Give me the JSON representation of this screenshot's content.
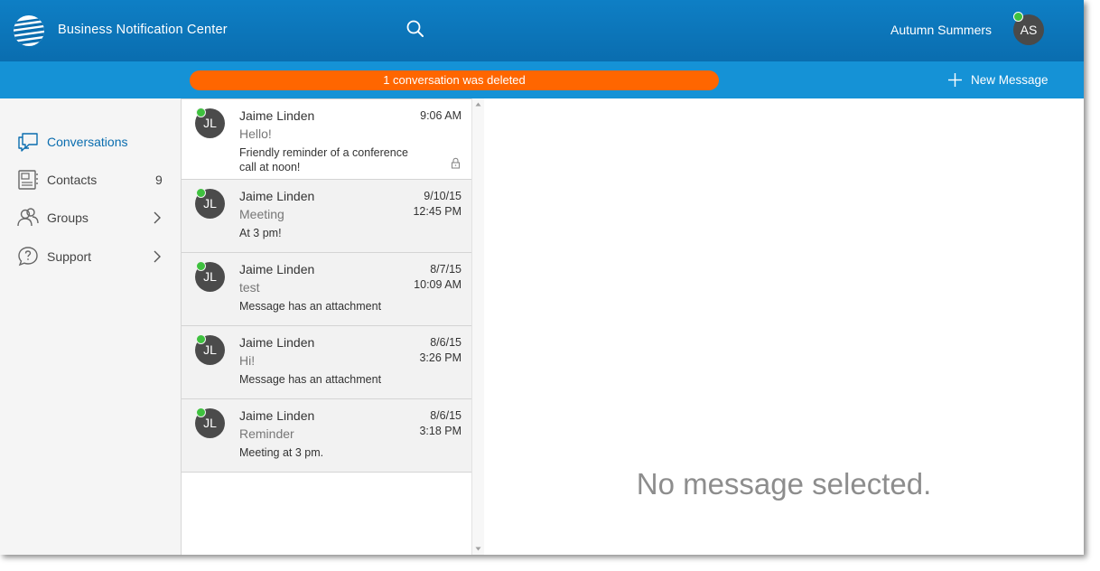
{
  "header": {
    "app_title": "Business Notification Center",
    "user_name": "Autumn Summers",
    "user_initials": "AS"
  },
  "subbar": {
    "toast": "1 conversation was deleted",
    "new_message_label": "New Message"
  },
  "sidebar": {
    "items": [
      {
        "label": "Conversations",
        "icon": "conversations-icon"
      },
      {
        "label": "Contacts",
        "count": "9",
        "icon": "contacts-icon"
      },
      {
        "label": "Groups",
        "icon": "groups-icon"
      },
      {
        "label": "Support",
        "icon": "support-icon"
      }
    ]
  },
  "conversations": [
    {
      "initials": "JL",
      "name": "Jaime Linden",
      "date": "9:06 AM",
      "time": "",
      "subject": "Hello!",
      "preview": "Friendly reminder of a conference call at noon!"
    },
    {
      "initials": "JL",
      "name": "Jaime Linden",
      "date": "9/10/15",
      "time": "12:45 PM",
      "subject": "Meeting",
      "preview": "At 3 pm!"
    },
    {
      "initials": "JL",
      "name": "Jaime Linden",
      "date": "8/7/15",
      "time": "10:09 AM",
      "subject": "test",
      "preview": "Message has an attachment"
    },
    {
      "initials": "JL",
      "name": "Jaime Linden",
      "date": "8/6/15",
      "time": "3:26 PM",
      "subject": "Hi!",
      "preview": "Message has an attachment"
    },
    {
      "initials": "JL",
      "name": "Jaime Linden",
      "date": "8/6/15",
      "time": "3:18 PM",
      "subject": "Reminder",
      "preview": "Meeting at 3 pm."
    }
  ],
  "detail": {
    "empty_text": "No message selected."
  },
  "colors": {
    "header": "#0a6daf",
    "subbar": "#1592d6",
    "toast": "#ff6600",
    "online": "#3fc13f"
  }
}
